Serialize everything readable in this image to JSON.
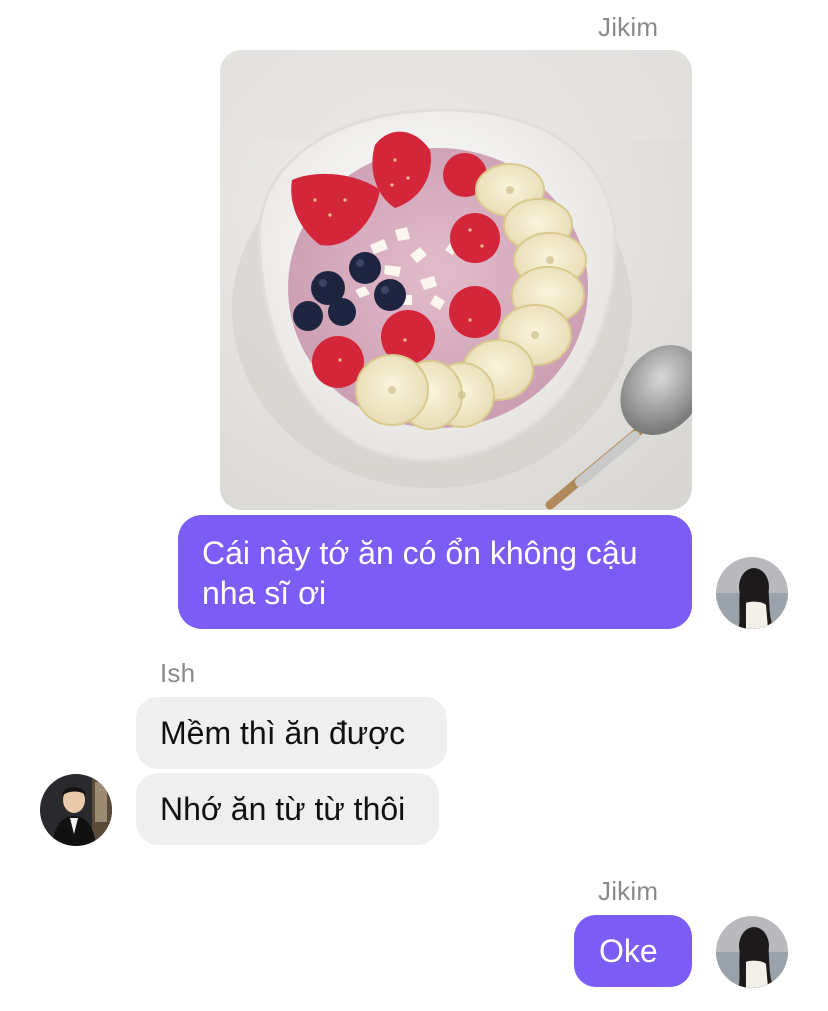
{
  "conversation": {
    "messages": [
      {
        "sender": "Jikim",
        "type": "image",
        "image_description": "smoothie-bowl-photo"
      },
      {
        "sender": "Jikim",
        "type": "text",
        "text": "Cái này tớ ăn có ổn không cậu nha sĩ ơi"
      },
      {
        "sender": "Ish",
        "type": "text",
        "text": "Mềm thì ăn được"
      },
      {
        "sender": "Ish",
        "type": "text",
        "text": "Nhớ ăn từ từ thôi"
      },
      {
        "sender": "Jikim",
        "type": "text",
        "text": "Oke"
      }
    ],
    "labels": {
      "jikim_1": "Jikim",
      "ish": "Ish",
      "jikim_2": "Jikim"
    },
    "text": {
      "m1_line1": "Cái này tớ ăn có ổn không cậu",
      "m1_line2": "nha sĩ ơi",
      "m2": "Mềm thì ăn được",
      "m3": "Nhớ ăn từ từ thôi",
      "m4": "Oke"
    }
  },
  "colors": {
    "outgoing_bubble": "#7b5cf5",
    "incoming_bubble": "#efefef",
    "sender_label": "#8a8a8e"
  },
  "icons": {
    "jikim_avatar": "avatar-girl-icon",
    "ish_avatar": "avatar-boy-icon"
  }
}
